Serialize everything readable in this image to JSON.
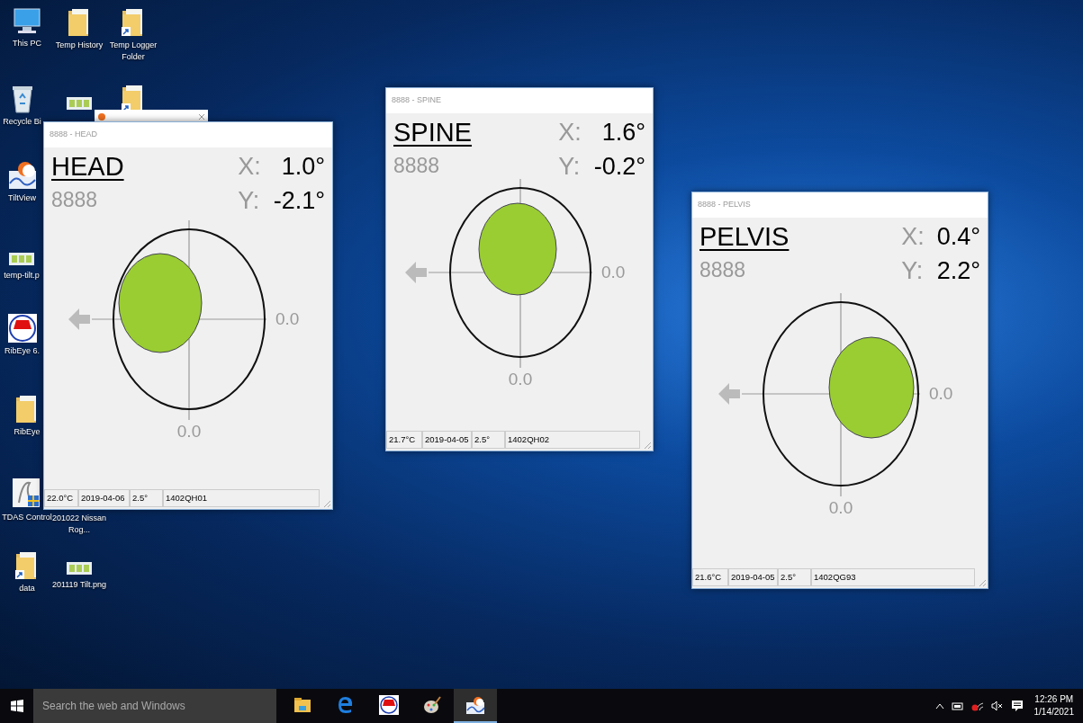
{
  "desktop_icons": [
    {
      "kind": "pc",
      "label": "This PC"
    },
    {
      "kind": "folder",
      "label": "Temp History"
    },
    {
      "kind": "folder-shortcut",
      "label": "Temp Logger Folder"
    },
    {
      "kind": "recycle",
      "label": "Recycle Bi"
    },
    {
      "kind": "image"
    },
    {
      "kind": "folder-shortcut"
    },
    {
      "kind": "tiltview",
      "label": "TiltView"
    },
    {
      "kind": "image",
      "label": "temp-tilt.p"
    },
    {
      "kind": "ribeye",
      "label": "RibEye 6."
    },
    {
      "kind": "folder",
      "label": "RibEye"
    },
    {
      "kind": "tdas",
      "label": "TDAS Control"
    },
    {
      "kind": "none",
      "label": "201022 Nissan Rog..."
    },
    {
      "kind": "folder-shortcut",
      "label": "data"
    },
    {
      "kind": "image",
      "label": "201119 Tilt.png"
    }
  ],
  "windows": [
    {
      "title": "8888 - HEAD",
      "name": "HEAD",
      "id": "8888",
      "x_label": "X:",
      "x_value": "1.0°",
      "y_label": "Y:",
      "y_value": "-2.1°",
      "right_axis_label": "0.0",
      "bottom_axis_label": "0.0",
      "status": [
        "22.0°C",
        "2019-04-06",
        "2.5°",
        "1402QH01"
      ]
    },
    {
      "title": "8888 - SPINE",
      "name": "SPINE",
      "id": "8888",
      "x_label": "X:",
      "x_value": "1.6°",
      "y_label": "Y:",
      "y_value": "-0.2°",
      "right_axis_label": "0.0",
      "bottom_axis_label": "0.0",
      "status": [
        "21.7°C",
        "2019-04-05",
        "2.5°",
        "1402QH02"
      ]
    },
    {
      "title": "8888 - PELVIS",
      "name": "PELVIS",
      "id": "8888",
      "x_label": "X:",
      "x_value": "0.4°",
      "y_label": "Y:",
      "y_value": "2.2°",
      "right_axis_label": "0.0",
      "bottom_axis_label": "0.0",
      "status": [
        "21.6°C",
        "2019-04-05",
        "2.5°",
        "1402QG93"
      ]
    }
  ],
  "taskbar": {
    "search_placeholder": "Search the web and Windows",
    "apps": [
      {
        "kind": "folder",
        "selected": false
      },
      {
        "kind": "edge",
        "selected": false
      },
      {
        "kind": "ribeye",
        "selected": false
      },
      {
        "kind": "paint",
        "selected": false
      },
      {
        "kind": "tiltview",
        "selected": true
      }
    ],
    "time": "12:26 PM",
    "date": "1/14/2021"
  }
}
